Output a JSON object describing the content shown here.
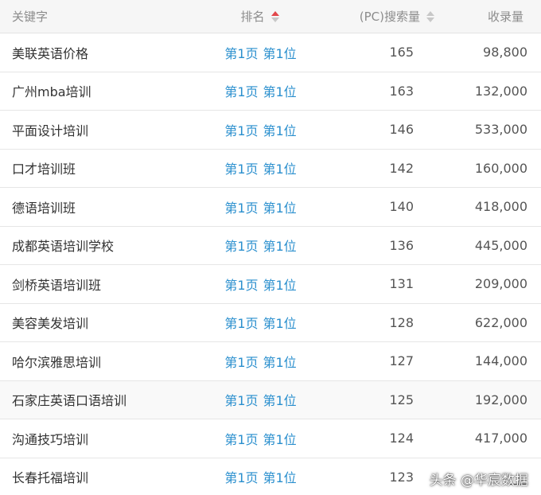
{
  "header": {
    "keyword": "关键字",
    "rank": "排名",
    "pc_volume": "(PC)搜索量",
    "indexed": "收录量"
  },
  "colors": {
    "rank_link": "#2a8fce",
    "sort_active": "#e2474b",
    "sort_inactive": "#c8c8c8"
  },
  "rows": [
    {
      "keyword": "美联英语价格",
      "page": "第1页",
      "pos": "第1位",
      "pc": "165",
      "indexed": "98,800"
    },
    {
      "keyword": "广州mba培训",
      "page": "第1页",
      "pos": "第1位",
      "pc": "163",
      "indexed": "132,000"
    },
    {
      "keyword": "平面设计培训",
      "page": "第1页",
      "pos": "第1位",
      "pc": "146",
      "indexed": "533,000"
    },
    {
      "keyword": "口才培训班",
      "page": "第1页",
      "pos": "第1位",
      "pc": "142",
      "indexed": "160,000"
    },
    {
      "keyword": "德语培训班",
      "page": "第1页",
      "pos": "第1位",
      "pc": "140",
      "indexed": "418,000"
    },
    {
      "keyword": "成都英语培训学校",
      "page": "第1页",
      "pos": "第1位",
      "pc": "136",
      "indexed": "445,000"
    },
    {
      "keyword": "剑桥英语培训班",
      "page": "第1页",
      "pos": "第1位",
      "pc": "131",
      "indexed": "209,000"
    },
    {
      "keyword": "美容美发培训",
      "page": "第1页",
      "pos": "第1位",
      "pc": "128",
      "indexed": "622,000"
    },
    {
      "keyword": "哈尔滨雅思培训",
      "page": "第1页",
      "pos": "第1位",
      "pc": "127",
      "indexed": "144,000"
    },
    {
      "keyword": "石家庄英语口语培训",
      "page": "第1页",
      "pos": "第1位",
      "pc": "125",
      "indexed": "192,000"
    },
    {
      "keyword": "沟通技巧培训",
      "page": "第1页",
      "pos": "第1位",
      "pc": "124",
      "indexed": "417,000"
    },
    {
      "keyword": "长春托福培训",
      "page": "第1页",
      "pos": "第1位",
      "pc": "123",
      "indexed": "___"
    }
  ],
  "watermark": "头条 @华宸数据"
}
